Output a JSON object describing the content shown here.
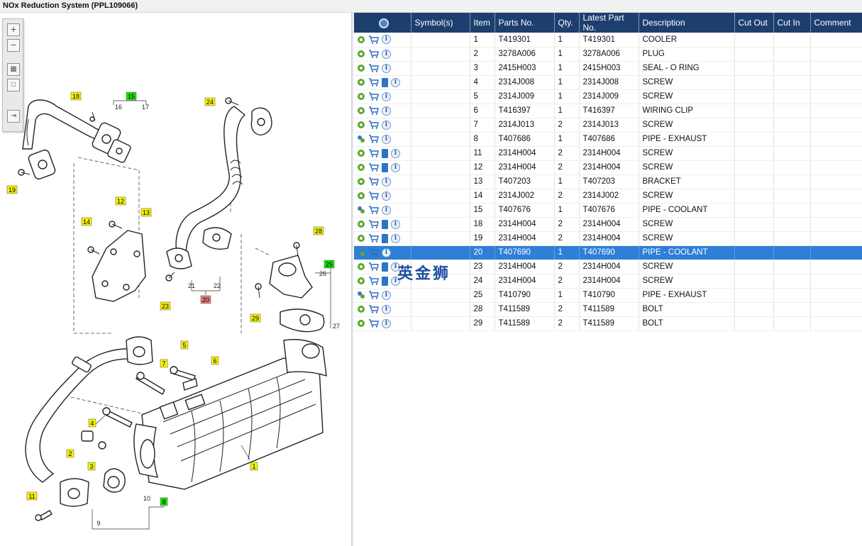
{
  "window": {
    "title": "NOx Reduction System (PPL109066)"
  },
  "table": {
    "columns": [
      "",
      "Symbol(s)",
      "Item",
      "Parts No.",
      "Qty.",
      "Latest Part No.",
      "Description",
      "Cut Out",
      "Cut In",
      "Comment"
    ],
    "rows": [
      {
        "item": "1",
        "parts_no": "T419301",
        "qty": "1",
        "latest": "T419301",
        "desc": "COOLER",
        "gear": "single",
        "doc": false
      },
      {
        "item": "2",
        "parts_no": "3278A006",
        "qty": "1",
        "latest": "3278A006",
        "desc": "PLUG",
        "gear": "single",
        "doc": false
      },
      {
        "item": "3",
        "parts_no": "2415H003",
        "qty": "1",
        "latest": "2415H003",
        "desc": "SEAL - O RING",
        "gear": "single",
        "doc": false
      },
      {
        "item": "4",
        "parts_no": "2314J008",
        "qty": "1",
        "latest": "2314J008",
        "desc": "SCREW",
        "gear": "single",
        "doc": true
      },
      {
        "item": "5",
        "parts_no": "2314J009",
        "qty": "1",
        "latest": "2314J009",
        "desc": "SCREW",
        "gear": "single",
        "doc": false
      },
      {
        "item": "6",
        "parts_no": "T416397",
        "qty": "1",
        "latest": "T416397",
        "desc": "WIRING CLIP",
        "gear": "single",
        "doc": false
      },
      {
        "item": "7",
        "parts_no": "2314J013",
        "qty": "2",
        "latest": "2314J013",
        "desc": "SCREW",
        "gear": "single",
        "doc": false
      },
      {
        "item": "8",
        "parts_no": "T407686",
        "qty": "1",
        "latest": "T407686",
        "desc": "PIPE - EXHAUST",
        "gear": "multi",
        "doc": false
      },
      {
        "item": "11",
        "parts_no": "2314H004",
        "qty": "2",
        "latest": "2314H004",
        "desc": "SCREW",
        "gear": "single",
        "doc": true
      },
      {
        "item": "12",
        "parts_no": "2314H004",
        "qty": "2",
        "latest": "2314H004",
        "desc": "SCREW",
        "gear": "single",
        "doc": true
      },
      {
        "item": "13",
        "parts_no": "T407203",
        "qty": "1",
        "latest": "T407203",
        "desc": "BRACKET",
        "gear": "single",
        "doc": false
      },
      {
        "item": "14",
        "parts_no": "2314J002",
        "qty": "2",
        "latest": "2314J002",
        "desc": "SCREW",
        "gear": "single",
        "doc": false
      },
      {
        "item": "15",
        "parts_no": "T407676",
        "qty": "1",
        "latest": "T407676",
        "desc": "PIPE - COOLANT",
        "gear": "multi",
        "doc": false
      },
      {
        "item": "18",
        "parts_no": "2314H004",
        "qty": "2",
        "latest": "2314H004",
        "desc": "SCREW",
        "gear": "single",
        "doc": true
      },
      {
        "item": "19",
        "parts_no": "2314H004",
        "qty": "2",
        "latest": "2314H004",
        "desc": "SCREW",
        "gear": "single",
        "doc": true
      },
      {
        "item": "20",
        "parts_no": "T407690",
        "qty": "1",
        "latest": "T407690",
        "desc": "PIPE - COOLANT",
        "gear": "multi",
        "doc": false,
        "selected": true
      },
      {
        "item": "23",
        "parts_no": "2314H004",
        "qty": "2",
        "latest": "2314H004",
        "desc": "SCREW",
        "gear": "single",
        "doc": true
      },
      {
        "item": "24",
        "parts_no": "2314H004",
        "qty": "2",
        "latest": "2314H004",
        "desc": "SCREW",
        "gear": "single",
        "doc": true
      },
      {
        "item": "25",
        "parts_no": "T410790",
        "qty": "1",
        "latest": "T410790",
        "desc": "PIPE - EXHAUST",
        "gear": "multi",
        "doc": false
      },
      {
        "item": "28",
        "parts_no": "T411589",
        "qty": "2",
        "latest": "T411589",
        "desc": "BOLT",
        "gear": "single",
        "doc": false
      },
      {
        "item": "29",
        "parts_no": "T411589",
        "qty": "2",
        "latest": "T411589",
        "desc": "BOLT",
        "gear": "single",
        "doc": false
      }
    ]
  },
  "diagram": {
    "callouts": [
      {
        "label": "18",
        "color": "yellow"
      },
      {
        "label": "15",
        "color": "green"
      },
      {
        "label": "24",
        "color": "yellow"
      },
      {
        "label": "19",
        "color": "yellow"
      },
      {
        "label": "12",
        "color": "yellow"
      },
      {
        "label": "13",
        "color": "yellow"
      },
      {
        "label": "14",
        "color": "yellow"
      },
      {
        "label": "28",
        "color": "yellow"
      },
      {
        "label": "25",
        "color": "green"
      },
      {
        "label": "23",
        "color": "yellow"
      },
      {
        "label": "20",
        "color": "red"
      },
      {
        "label": "29",
        "color": "yellow"
      },
      {
        "label": "5",
        "color": "yellow"
      },
      {
        "label": "6",
        "color": "yellow"
      },
      {
        "label": "7",
        "color": "yellow"
      },
      {
        "label": "4",
        "color": "yellow"
      },
      {
        "label": "2",
        "color": "yellow"
      },
      {
        "label": "3",
        "color": "yellow"
      },
      {
        "label": "1",
        "color": "yellow"
      },
      {
        "label": "11",
        "color": "yellow"
      },
      {
        "label": "8",
        "color": "green"
      }
    ],
    "plain_labels": [
      "16",
      "17",
      "21",
      "22",
      "26",
      "27",
      "10",
      "9"
    ]
  },
  "watermark": "英金狮",
  "colors": {
    "header": "#1c3f6e",
    "selected_row": "#2f7fd6",
    "callout_yellow": "#f5f200",
    "callout_green": "#19e600",
    "callout_red": "#ee7b7b",
    "gear_green": "#5aa832"
  }
}
